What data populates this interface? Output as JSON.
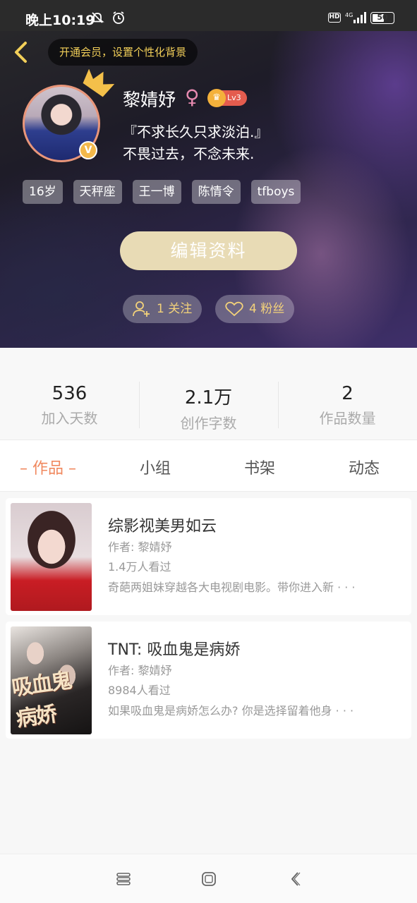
{
  "status_bar": {
    "time": "晚上10:19",
    "network": "4G",
    "hd": "HD",
    "battery": "50"
  },
  "header": {
    "vip_banner": "开通会员，设置个性化背景",
    "user_name": "黎婧妤",
    "gender_symbol": "♀",
    "level": "Lv3",
    "verified_badge": "V",
    "bio_line1": "『不求长久只求淡泊.』",
    "bio_line2": "不畏过去，不念未来.",
    "tags": [
      "16岁",
      "天秤座",
      "王一博",
      "陈情令",
      "tfboys"
    ],
    "edit_button": "编辑资料",
    "following_label": "1 关注",
    "followers_label": "4 粉丝"
  },
  "stats": [
    {
      "value": "536",
      "label": "加入天数"
    },
    {
      "value": "2.1万",
      "label": "创作字数"
    },
    {
      "value": "2",
      "label": "作品数量"
    }
  ],
  "tabs": {
    "works": "– 作品 –",
    "group": "小组",
    "shelf": "书架",
    "feed": "动态"
  },
  "works": [
    {
      "title": "综影视美男如云",
      "author": "作者: 黎婧妤",
      "views": "1.4万人看过",
      "description": "奇葩两姐妹穿越各大电视剧电影。带你进入新 · · ·"
    },
    {
      "title": "TNT: 吸血鬼是病娇",
      "author": "作者: 黎婧妤",
      "views": "8984人看过",
      "description": "如果吸血鬼是病娇怎么办? 你是选择留着他身 · · ·",
      "cover_text": "吸血鬼病娇"
    }
  ],
  "colors": {
    "accent": "#f0885e",
    "vip_gold": "#f2cf59",
    "edit_button": "#e8dbb5"
  }
}
